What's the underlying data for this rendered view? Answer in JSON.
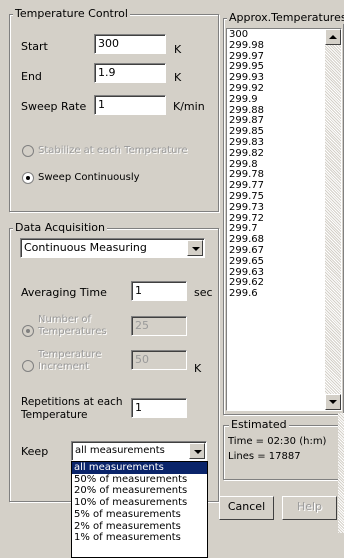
{
  "temperature_control": {
    "title": "Temperature Control",
    "start_label": "Start",
    "start_value": "300",
    "start_unit": "K",
    "end_label": "End",
    "end_value": "1.9",
    "end_unit": "K",
    "sweep_rate_label": "Sweep Rate",
    "sweep_rate_value": "1",
    "sweep_rate_unit": "K/min",
    "stabilize_label": "Stabilize at each Temperature",
    "sweep_continuously_label": "Sweep Continuously"
  },
  "data_acquisition": {
    "title": "Data Acquisition",
    "mode_value": "Continuous Measuring",
    "averaging_time_label": "Averaging Time",
    "averaging_time_value": "1",
    "averaging_time_unit": "sec",
    "num_temps_label_1": "Number of",
    "num_temps_label_2": "Temperatures",
    "num_temps_value": "25",
    "temp_increment_label_1": "Temperature",
    "temp_increment_label_2": "Increment",
    "temp_increment_value": "50",
    "temp_increment_unit": "K",
    "repetitions_label_1": "Repetitions at each",
    "repetitions_label_2": "Temperature",
    "repetitions_value": "1",
    "keep_label": "Keep",
    "keep_value": "all measurements",
    "keep_options": [
      "all measurements",
      "50% of measurements",
      "20% of measurements",
      "10% of measurements",
      "5% of measurements",
      "2% of measurements",
      "1% of measurements"
    ]
  },
  "approx_temperatures": {
    "title": "Approx.Temperatures",
    "values": [
      "300",
      "299.98",
      "299.97",
      "299.95",
      "299.93",
      "299.92",
      "299.9",
      "299.88",
      "299.87",
      "299.85",
      "299.83",
      "299.82",
      "299.8",
      "299.78",
      "299.77",
      "299.75",
      "299.73",
      "299.72",
      "299.7",
      "299.68",
      "299.67",
      "299.65",
      "299.63",
      "299.62",
      "299.6"
    ]
  },
  "estimated": {
    "title": "Estimated",
    "time_text": "Time = 02:30 (h:m)",
    "lines_text": "Lines = 17887"
  },
  "buttons": {
    "cancel": "Cancel",
    "help": "Help"
  },
  "colors": {
    "face": "#d4d0c8",
    "highlight": "#0a246a"
  }
}
